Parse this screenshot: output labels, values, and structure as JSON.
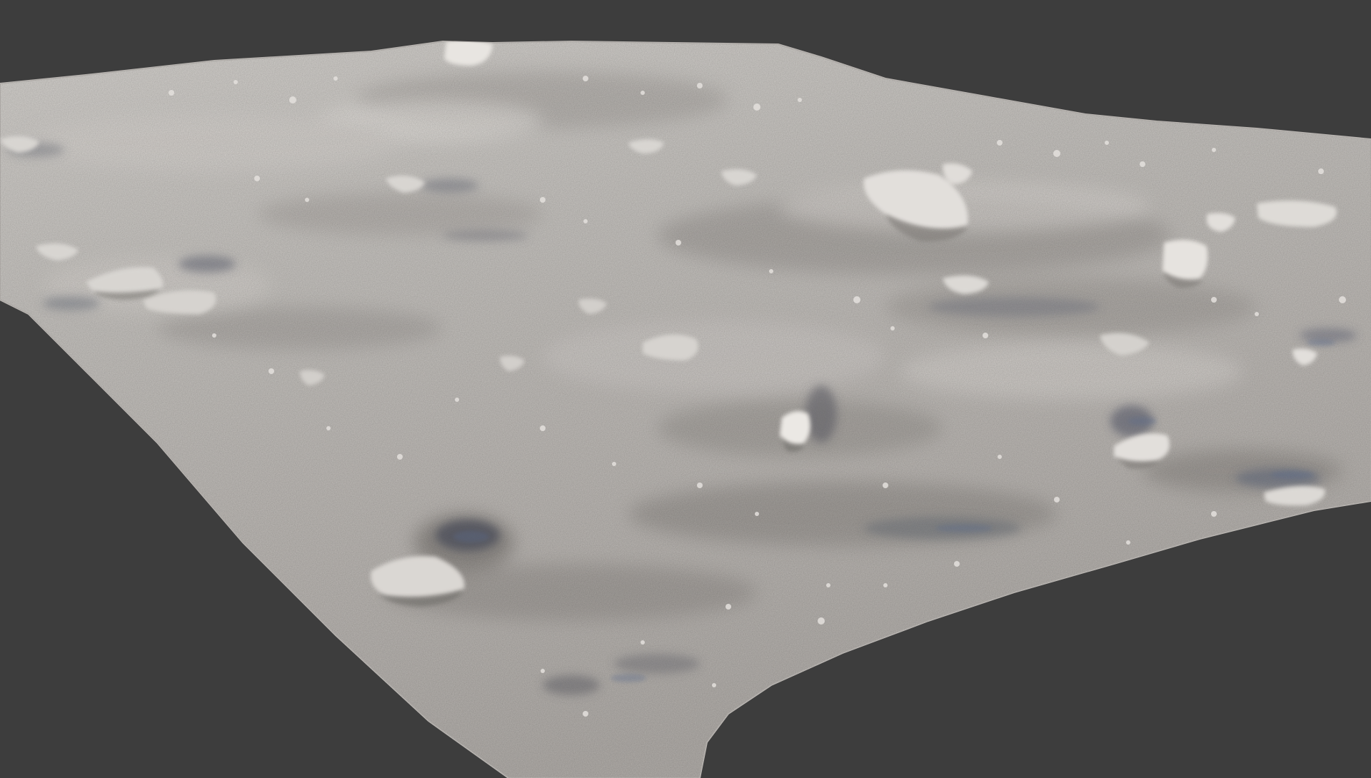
{
  "viewport": {
    "background_color": "#3d3d3d",
    "shading_mode": "solid",
    "terrain_base_color": "#c4c1bd",
    "terrain_highlight_color": "#e4e1dd",
    "terrain_shadow_color": "#6a6764",
    "shadow_tint_color": "#5c6a8a"
  }
}
